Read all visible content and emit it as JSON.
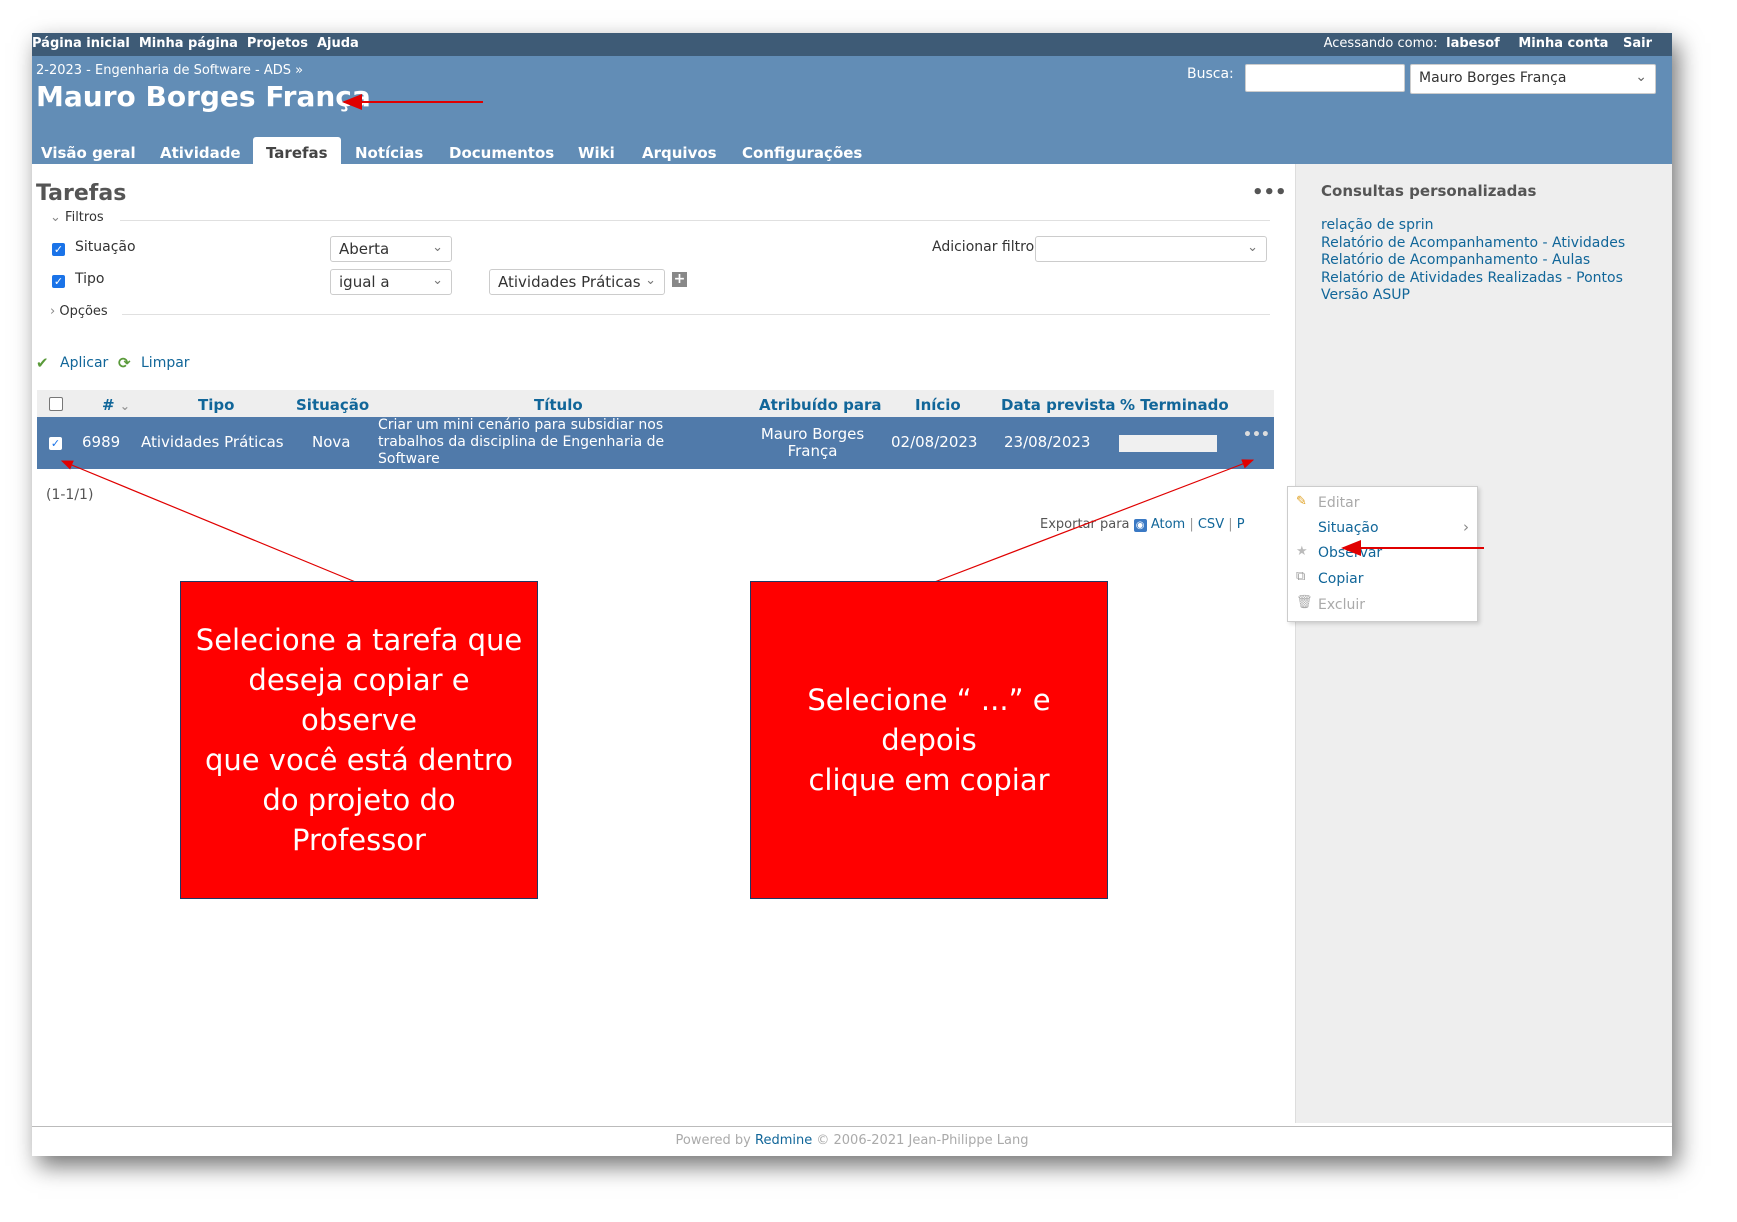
{
  "top_menu": {
    "items": [
      "Página inicial",
      "Minha página",
      "Projetos",
      "Ajuda"
    ],
    "logged_as_label": "Acessando como:",
    "logged_as_user": "labesof",
    "my_account": "Minha conta",
    "logout": "Sair"
  },
  "header": {
    "breadcrumb": "2-2023 - Engenharia de Software - ADS »",
    "title": "Mauro Borges França",
    "search_label": "Busca:",
    "search_value": "",
    "project_select": "Mauro Borges França"
  },
  "main_menu": {
    "tabs": [
      "Visão geral",
      "Atividade",
      "Tarefas",
      "Notícias",
      "Documentos",
      "Wiki",
      "Arquivos",
      "Configurações"
    ],
    "selected": "Tarefas"
  },
  "content": {
    "heading": "Tarefas",
    "more": "•••",
    "filters_legend": "Filtros",
    "filters": [
      {
        "label": "Situação",
        "checked": true,
        "operator": "Aberta",
        "value": ""
      },
      {
        "label": "Tipo",
        "checked": true,
        "operator": "igual a",
        "value": "Atividades Práticas"
      }
    ],
    "add_filter_label": "Adicionar filtro",
    "add_filter_value": "",
    "options_legend": "Opções",
    "apply": "Aplicar",
    "clear": "Limpar",
    "pagination": "(1-1/1)",
    "export_label": "Exportar para",
    "export_atom": "Atom",
    "export_csv": "CSV",
    "export_pdf": "P"
  },
  "table": {
    "columns": [
      "#",
      "Tipo",
      "Situação",
      "Título",
      "Atribuído para",
      "Início",
      "Data prevista",
      "% Terminado"
    ],
    "rows": [
      {
        "id": "6989",
        "tracker": "Atividades Práticas",
        "status": "Nova",
        "subject_lines": [
          "Criar um mini cenário para subsidiar nos",
          "trabalhos da disciplina de Engenharia de",
          "Software"
        ],
        "assignee_lines": [
          "Mauro Borges",
          "França"
        ],
        "start": "02/08/2023",
        "due": "23/08/2023",
        "done_ratio": 0,
        "selected": true
      }
    ]
  },
  "context_menu": {
    "items": [
      {
        "label": "Editar",
        "enabled": false,
        "icon": "pencil-icon"
      },
      {
        "label": "Situação",
        "enabled": true,
        "icon": "",
        "submenu": true
      },
      {
        "label": "Observar",
        "enabled": true,
        "icon": "star-icon"
      },
      {
        "label": "Copiar",
        "enabled": true,
        "icon": "copy-icon"
      },
      {
        "label": "Excluir",
        "enabled": false,
        "icon": "trash-icon"
      }
    ]
  },
  "sidebar": {
    "title": "Consultas personalizadas",
    "queries": [
      "relação de sprin",
      "Relatório de Acompanhamento - Atividades",
      "Relatório de Acompanhamento - Aulas",
      "Relatório de Atividades Realizadas - Pontos",
      "Versão ASUP"
    ]
  },
  "footer": {
    "powered_by": "Powered by",
    "redmine": "Redmine",
    "copyright": "© 2006-2021 Jean-Philippe Lang"
  },
  "annotations": {
    "callout_left": [
      "Selecione a tarefa  que",
      "deseja copiar e observe",
      "que você está dentro",
      "do projeto do Professor"
    ],
    "callout_right": [
      "Selecione “ ...” e depois",
      "clique em copiar"
    ],
    "colors": {
      "callout": "#ff0000",
      "arrow": "#e00000",
      "header": "#628db6",
      "top_menu": "#3e5b76",
      "selected_row": "#507aaa"
    }
  }
}
